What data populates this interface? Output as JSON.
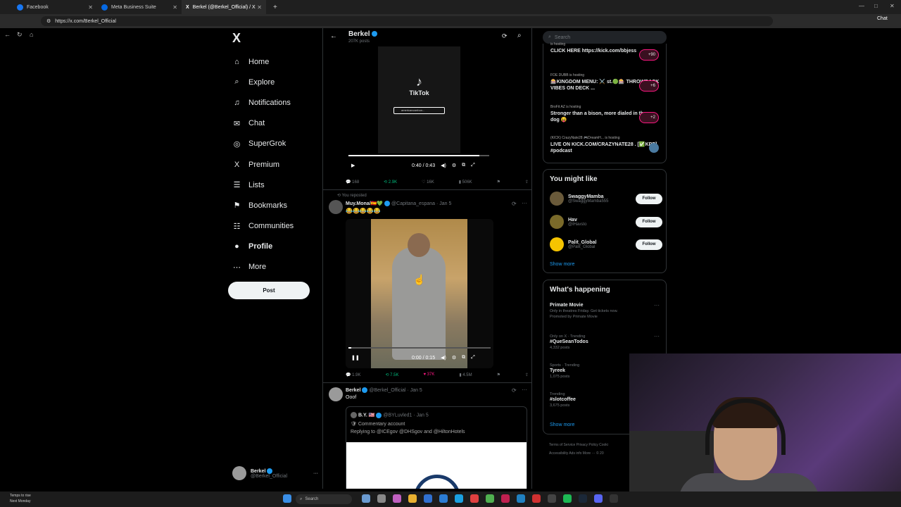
{
  "browser": {
    "tabs": [
      {
        "label": "Facebook",
        "color": "#1877f2"
      },
      {
        "label": "Meta Business Suite",
        "color": "#0668e1"
      },
      {
        "label": "Berkel (@Berkel_Official) / X",
        "color": "#ffffff"
      }
    ],
    "url": "https://x.com/Berkel_Official",
    "chat_label": "Chat"
  },
  "nav": {
    "logo": "X",
    "items": [
      {
        "label": "Home",
        "icon": "⌂"
      },
      {
        "label": "Explore",
        "icon": "⌕"
      },
      {
        "label": "Notifications",
        "icon": "♫"
      },
      {
        "label": "Chat",
        "icon": "✉"
      },
      {
        "label": "SuperGrok",
        "icon": "◎"
      },
      {
        "label": "Premium",
        "icon": "X"
      },
      {
        "label": "Lists",
        "icon": "☰"
      },
      {
        "label": "Bookmarks",
        "icon": "⚑"
      },
      {
        "label": "Communities",
        "icon": "☷"
      },
      {
        "label": "Profile",
        "icon": "●"
      },
      {
        "label": "More",
        "icon": "⋯"
      }
    ],
    "post_label": "Post",
    "account_name": "Berkel",
    "account_handle": "@Berkel_Official"
  },
  "feed": {
    "header_name": "Berkel",
    "header_sub": "207K posts",
    "tweet1": {
      "video_brand": "TikTok",
      "video_search": "americancarrbon...",
      "time": "0:40 / 0:43",
      "progress": 0.93,
      "replies": "168",
      "reposts": "2.9K",
      "likes": "16K",
      "views": "506K"
    },
    "tweet2": {
      "repost_label": "You reposted",
      "name": "Muy.Mona/🇪🇸💚",
      "handle": "@Capitana_espana",
      "date": "· Jan 5",
      "text": "😂😂😂😂😂",
      "time": "0:00 / 0:15",
      "progress": 0.02,
      "replies": "1.9K",
      "reposts": "7.5K",
      "likes": "37K",
      "views": "4.5M"
    },
    "tweet3": {
      "name": "Berkel",
      "handle": "@Berkel_Official",
      "date": "· Jan 5",
      "text": "Ooof",
      "quote_name": "B.Y. 🇺🇸",
      "quote_handle": "@BYLuvled1",
      "quote_date": "· Jan 5",
      "quote_badge": "🛡 Commentary account",
      "quote_reply": "Replying to @ICEgov @DHSgov and @HiltonHotels"
    }
  },
  "right": {
    "search_placeholder": "Search",
    "spaces": [
      {
        "host": "is hosting",
        "title": "CLICK HERE https://kick.com/bbjess",
        "count": "+90"
      },
      {
        "host": "FOE DUBB  is hosting",
        "title": "🎰KINGDOM MENU: ⚔️ st.🟢🎰 THROWBACK VIBES ON DECK ...",
        "count": "+6"
      },
      {
        "host": "BroFit AZ  is hosting",
        "title": "Stronger than a bison, more dialed in than a dog 😝",
        "count": "+2"
      },
      {
        "host": "(KICK) CrazyNate28 🎮DreamH...  is hosting",
        "title": "LIVE ON KICK.COM/CRAZYNATE28 . [✅KPP] #podcast",
        "count": ""
      }
    ],
    "wtf_title": "You might like",
    "wtf": [
      {
        "name": "SwaggyMamba",
        "handle": "@SwaggyMamba555",
        "color": "#6a5a3a"
      },
      {
        "name": "Hav",
        "handle": "@IHavsto",
        "color": "#7a6a2a"
      },
      {
        "name": "Palit_Global",
        "handle": "@Palit_Global",
        "color": "#f5c400"
      }
    ],
    "follow_label": "Follow",
    "show_more": "Show more",
    "trends_title": "What's happening",
    "trends": [
      {
        "context": "",
        "title": "Primate Movie",
        "desc": "Only in theatres Friday. Get tickets now.",
        "extra": "Promoted by Primate Movie"
      },
      {
        "context": "Only on X · Trending",
        "title": "#QueSeanTodos",
        "desc": "4,332 posts",
        "extra": ""
      },
      {
        "context": "Sports · Trending",
        "title": "Tyreek",
        "desc": "1,075 posts",
        "extra": ""
      },
      {
        "context": "Trending",
        "title": "#slotcoffee",
        "desc": "3,675 posts",
        "extra": ""
      }
    ],
    "footer1": "Terms of Service   Privacy Policy   Cooki",
    "footer2": "Accessibility   Ads info   More ···   © 20"
  },
  "taskbar": {
    "weather1": "Temps to rise",
    "weather2": "Next Monday",
    "search": "Search"
  }
}
